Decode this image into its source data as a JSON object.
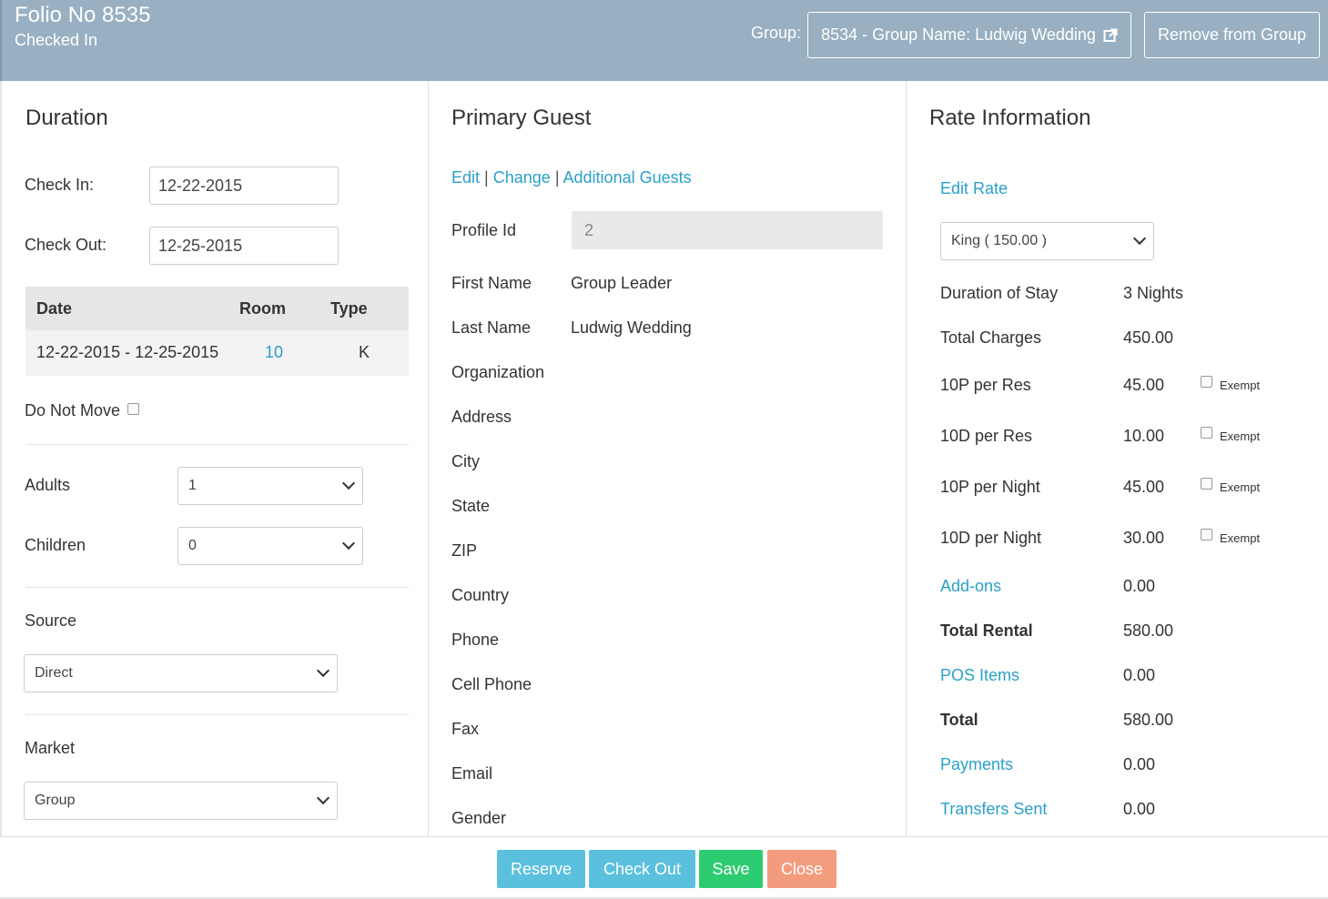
{
  "header": {
    "folio_title": "Folio No 8535",
    "status": "Checked In",
    "group_label": "Group:",
    "group_button": "8534 - Group Name: Ludwig Wedding",
    "remove_button": "Remove from Group"
  },
  "duration": {
    "title": "Duration",
    "check_in_label": "Check In:",
    "check_in_value": "12-22-2015",
    "check_out_label": "Check Out:",
    "check_out_value": "12-25-2015",
    "table": {
      "headers": [
        "Date",
        "Room",
        "Type"
      ],
      "rows": [
        [
          "12-22-2015 - 12-25-2015",
          "10",
          "K"
        ]
      ]
    },
    "do_not_move_label": "Do Not Move",
    "adults_label": "Adults",
    "adults_value": "1",
    "children_label": "Children",
    "children_value": "0",
    "source_label": "Source",
    "source_value": "Direct",
    "market_label": "Market",
    "market_value": "Group"
  },
  "primary_guest": {
    "title": "Primary Guest",
    "links": [
      "Edit",
      "Change",
      "Additional Guests"
    ],
    "separator": "|",
    "profile_id_label": "Profile Id",
    "profile_id_value": "2",
    "first_name_label": "First Name",
    "first_name_value": "Group Leader",
    "last_name_label": "Last Name",
    "last_name_value": "Ludwig Wedding",
    "fields": [
      "Organization",
      "Address",
      "City",
      "State",
      "ZIP",
      "Country",
      "Phone",
      "Cell Phone",
      "Fax",
      "Email",
      "Gender"
    ]
  },
  "rate": {
    "title": "Rate Information",
    "edit_rate": "Edit Rate",
    "rate_select": "King ( 150.00 )",
    "duration_label": "Duration of Stay",
    "duration_value": "3 Nights",
    "total_charges_label": "Total Charges",
    "total_charges_value": "450.00",
    "taxes": [
      {
        "label": "10P per Res",
        "value": "45.00",
        "exempt": "Exempt"
      },
      {
        "label": "10D per Res",
        "value": "10.00",
        "exempt": "Exempt"
      },
      {
        "label": "10P per Night",
        "value": "45.00",
        "exempt": "Exempt"
      },
      {
        "label": "10D per Night",
        "value": "30.00",
        "exempt": "Exempt"
      }
    ],
    "addons_label": "Add-ons",
    "addons_value": "0.00",
    "total_rental_label": "Total Rental",
    "total_rental_value": "580.00",
    "pos_label": "POS Items",
    "pos_value": "0.00",
    "total_label": "Total",
    "total_value": "580.00",
    "payments_label": "Payments",
    "payments_value": "0.00",
    "transfers_label": "Transfers Sent",
    "transfers_value": "0.00"
  },
  "footer": {
    "reserve": "Reserve",
    "check_out": "Check Out",
    "save": "Save",
    "close": "Close"
  },
  "colors": {
    "header_bg": "#98b0c1",
    "link": "#2aa0c8",
    "info_button": "#5bc0de",
    "save_button": "#2ecc71",
    "close_button": "#f39c7d"
  }
}
